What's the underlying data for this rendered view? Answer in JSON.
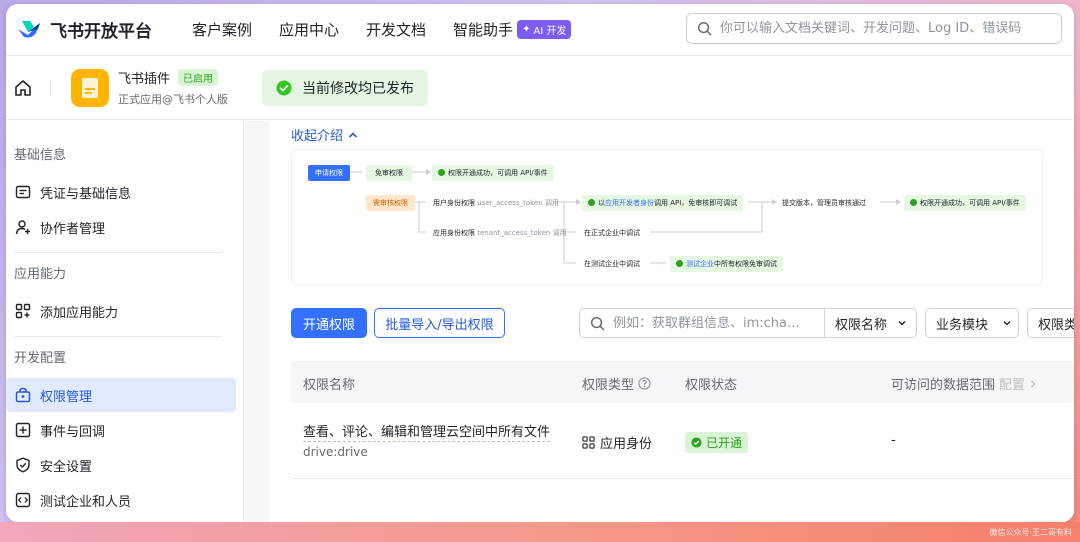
{
  "brand": {
    "name": "飞书开放平台"
  },
  "topnav": {
    "items": [
      "客户案例",
      "应用中心",
      "开发文档",
      "智能助手"
    ],
    "ai_badge": "AI 开发",
    "search_placeholder": "你可以输入文档关键词、开发问题、Log ID、错误码"
  },
  "app": {
    "name": "飞书插件",
    "status": "已启用",
    "subtitle": "正式应用@飞书个人版",
    "toast": "当前修改均已发布"
  },
  "sidebar": {
    "groups": [
      {
        "title": "基础信息",
        "items": [
          {
            "label": "凭证与基础信息",
            "icon": "credential-icon"
          },
          {
            "label": "协作者管理",
            "icon": "collaborator-icon"
          }
        ]
      },
      {
        "title": "应用能力",
        "items": [
          {
            "label": "添加应用能力",
            "icon": "capability-icon"
          }
        ]
      },
      {
        "title": "开发配置",
        "items": [
          {
            "label": "权限管理",
            "icon": "permission-icon",
            "active": true
          },
          {
            "label": "事件与回调",
            "icon": "event-icon"
          },
          {
            "label": "安全设置",
            "icon": "shield-icon"
          },
          {
            "label": "测试企业和人员",
            "icon": "code-icon"
          }
        ]
      }
    ]
  },
  "main": {
    "collapse_label": "收起介绍",
    "flow": {
      "apply": "申请权限",
      "free": "免审权限",
      "free_result": "权限开通成功，可调用 API/事件",
      "review": "需审核权限",
      "user_perm": "用户身份权限",
      "user_token": "user_access_token 调用",
      "tenant_perm": "应用身份权限",
      "tenant_token": "tenant_access_token 调用",
      "dev_call_pre": "以",
      "dev_call_mid": "应用开发者身份",
      "dev_call_post": "调用 API，免审核即可调试",
      "submit": "提交版本，管理员审核通过",
      "final_result": "权限开通成功，可调用 API/事件",
      "formal_test": "在正式企业中调试",
      "test_enterprise": "在测试企业中调试",
      "test_pre": "测试企业",
      "test_post": "中所有权限免审调试"
    },
    "toolbar": {
      "enable": "开通权限",
      "batch": "批量导入/导出权限",
      "search_placeholder": "例如：获取群组信息、im:cha...",
      "name_select": "权限名称",
      "module_select": "业务模块",
      "type_select": "权限类"
    },
    "table": {
      "headers": [
        "权限名称",
        "权限类型",
        "权限状态",
        "可访问的数据范围",
        "配置"
      ],
      "rows": [
        {
          "name": "查看、评论、编辑和管理云空间中所有文件",
          "code": "drive:drive",
          "type": "应用身份",
          "status": "已开通",
          "scope": "-"
        }
      ]
    }
  },
  "watermark": "微信公众号·王二哥有料",
  "colors": {
    "primary": "#3370ff",
    "success": "#2ea121",
    "app_icon": "#ffb400",
    "ai": "#7c5cf2"
  }
}
